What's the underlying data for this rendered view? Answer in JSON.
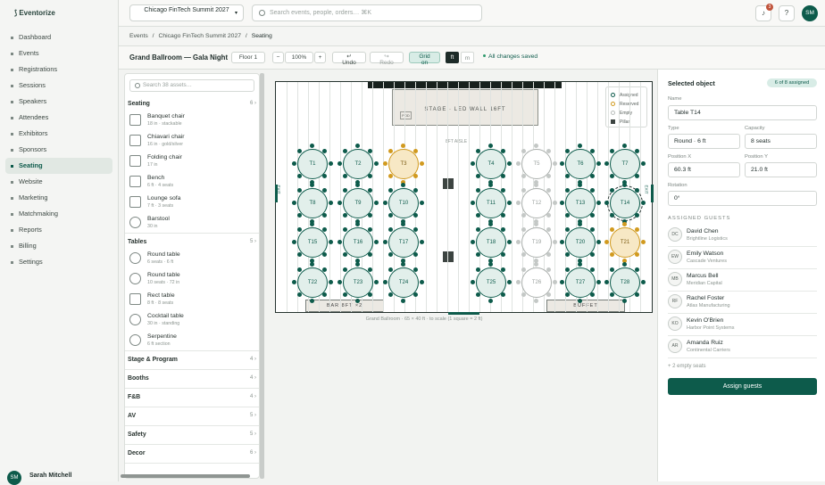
{
  "app": {
    "logo": "Eventorize"
  },
  "sidebar": {
    "items": [
      {
        "label": "Dashboard"
      },
      {
        "label": "Events"
      },
      {
        "label": "Registrations"
      },
      {
        "label": "Sessions"
      },
      {
        "label": "Speakers"
      },
      {
        "label": "Attendees"
      },
      {
        "label": "Exhibitors"
      },
      {
        "label": "Sponsors"
      },
      {
        "label": "Seating",
        "active": true
      },
      {
        "label": "Website"
      },
      {
        "label": "Marketing"
      },
      {
        "label": "Matchmaking"
      },
      {
        "label": "Reports"
      },
      {
        "label": "Billing"
      },
      {
        "label": "Settings"
      }
    ],
    "user": {
      "initials": "SM",
      "name": "Sarah Mitchell"
    }
  },
  "topbar": {
    "event_select": "Chicago FinTech Summit 2027",
    "search_placeholder": "Search events, people, orders…  ⌘K",
    "notifications_count": "3",
    "help_label": "?",
    "user_initials": "SM"
  },
  "breadcrumb": {
    "items": [
      "Events",
      "Chicago FinTech Summit 2027",
      "Seating"
    ],
    "sep": "/"
  },
  "toolbar": {
    "room_title": "Grand Ballroom — Gala Night",
    "floor": "Floor 1",
    "zoom_minus": "−",
    "zoom": "100%",
    "zoom_plus": "+",
    "undo": "Undo",
    "redo": "Redo",
    "grid": "Grid",
    "grid_state": "on",
    "unit_ft": "ft",
    "unit_m": "m",
    "saved": "All changes saved"
  },
  "assets": {
    "search_placeholder": "Search 38 assets…",
    "sections": [
      {
        "title": "Seating",
        "count": "6",
        "items": [
          {
            "name": "Banquet chair",
            "sub": "18 in · stackable",
            "shape": "square"
          },
          {
            "name": "Chiavari chair",
            "sub": "16 in · gold/silver",
            "shape": "square"
          },
          {
            "name": "Folding chair",
            "sub": "17 in",
            "shape": "square"
          },
          {
            "name": "Bench",
            "sub": "6 ft · 4 seats",
            "shape": "square"
          },
          {
            "name": "Lounge sofa",
            "sub": "7 ft · 3 seats",
            "shape": "square"
          },
          {
            "name": "Barstool",
            "sub": "30 in",
            "shape": "round"
          }
        ]
      },
      {
        "title": "Tables",
        "count": "5",
        "items": [
          {
            "name": "Round table",
            "sub": "6 seats · 6 ft",
            "shape": "round"
          },
          {
            "name": "Round table",
            "sub": "10 seats · 72 in",
            "shape": "round"
          },
          {
            "name": "Rect table",
            "sub": "8 ft · 8 seats",
            "shape": "square"
          },
          {
            "name": "Cocktail table",
            "sub": "30 in · standing",
            "shape": "round"
          },
          {
            "name": "Serpentine",
            "sub": "6 ft section",
            "shape": "round"
          }
        ]
      },
      {
        "title": "Stage & Program",
        "count": "4"
      },
      {
        "title": "Booths",
        "count": "4"
      },
      {
        "title": "F&B",
        "count": "4"
      },
      {
        "title": "AV",
        "count": "5"
      },
      {
        "title": "Safety",
        "count": "5"
      },
      {
        "title": "Decor",
        "count": "6"
      }
    ]
  },
  "floorplan": {
    "stage_label": "STAGE · LED WALL 16FT",
    "podium_label": "POD",
    "aisle_label": "8FT AISLE",
    "exit_label": "EXIT",
    "bar_label": "BAR 8FT ×2",
    "buffet_label": "BUFFET",
    "caption": "Grand Ballroom · 65 × 40 ft · to scale (1 square = 2 ft)",
    "legend": [
      {
        "label": "Assigned",
        "color": "#0d5b4b"
      },
      {
        "label": "Reserved",
        "color": "#d19a1f"
      },
      {
        "label": "Empty",
        "color": "#b8bdba"
      },
      {
        "label": "Pillar",
        "color": "#3c4441"
      }
    ],
    "tables": [
      {
        "id": "T1",
        "status": "assigned"
      },
      {
        "id": "T2",
        "status": "assigned"
      },
      {
        "id": "T3",
        "status": "reserved"
      },
      {
        "id": "T4",
        "status": "assigned"
      },
      {
        "id": "T5",
        "status": "empty"
      },
      {
        "id": "T6",
        "status": "assigned"
      },
      {
        "id": "T7",
        "status": "assigned"
      },
      {
        "id": "T8",
        "status": "assigned"
      },
      {
        "id": "T9",
        "status": "assigned"
      },
      {
        "id": "T10",
        "status": "assigned"
      },
      {
        "id": "T11",
        "status": "assigned"
      },
      {
        "id": "T12",
        "status": "empty"
      },
      {
        "id": "T13",
        "status": "assigned"
      },
      {
        "id": "T14",
        "status": "assigned",
        "selected": true
      },
      {
        "id": "T15",
        "status": "assigned"
      },
      {
        "id": "T16",
        "status": "assigned"
      },
      {
        "id": "T17",
        "status": "assigned"
      },
      {
        "id": "T18",
        "status": "assigned"
      },
      {
        "id": "T19",
        "status": "empty"
      },
      {
        "id": "T20",
        "status": "assigned"
      },
      {
        "id": "T21",
        "status": "reserved"
      },
      {
        "id": "T22",
        "status": "assigned"
      },
      {
        "id": "T23",
        "status": "assigned"
      },
      {
        "id": "T24",
        "status": "assigned"
      },
      {
        "id": "T25",
        "status": "assigned"
      },
      {
        "id": "T26",
        "status": "empty"
      },
      {
        "id": "T27",
        "status": "assigned"
      },
      {
        "id": "T28",
        "status": "assigned"
      }
    ]
  },
  "panel": {
    "title": "Selected object",
    "badge": "6 of 8 assigned",
    "name_label": "Name",
    "name_value": "Table T14",
    "type_label": "Type",
    "type_value": "Round · 6 ft",
    "capacity_label": "Capacity",
    "capacity_value": "8 seats",
    "posx_label": "Position X",
    "posx_value": "60.3 ft",
    "posy_label": "Position Y",
    "posy_value": "21.0 ft",
    "rotation_label": "Rotation",
    "rotation_value": "0°",
    "guests_heading": "ASSIGNED GUESTS",
    "guests": [
      {
        "initials": "DC",
        "name": "David Chen",
        "company": "Brightline Logistics"
      },
      {
        "initials": "EW",
        "name": "Emily Watson",
        "company": "Cascade Ventures"
      },
      {
        "initials": "MB",
        "name": "Marcus Bell",
        "company": "Meridian Capital"
      },
      {
        "initials": "RF",
        "name": "Rachel Foster",
        "company": "Atlas Manufacturing"
      },
      {
        "initials": "KO",
        "name": "Kevin O'Brien",
        "company": "Harbor Point Systems"
      },
      {
        "initials": "AR",
        "name": "Amanda Ruiz",
        "company": "Continental Carriers"
      }
    ],
    "empty_seats": "+ 2 empty seats",
    "assign_button": "Assign guests"
  }
}
